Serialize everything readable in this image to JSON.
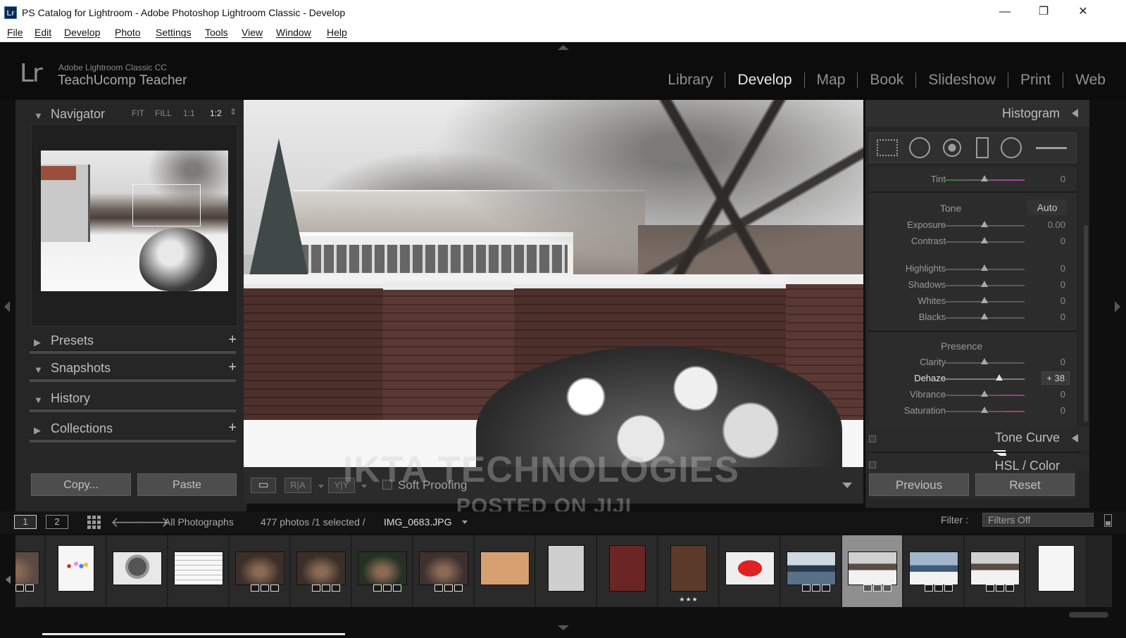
{
  "window": {
    "title": "PS Catalog for Lightroom - Adobe Photoshop Lightroom Classic - Develop",
    "app_icon": "Lr",
    "minimize": "—",
    "restore": "❐",
    "close": "✕"
  },
  "menu": [
    "File",
    "Edit",
    "Develop",
    "Photo",
    "Settings",
    "Tools",
    "View",
    "Window",
    "Help"
  ],
  "identity": {
    "logo": "Lr",
    "product": "Adobe Lightroom Classic CC",
    "user": "TeachUcomp Teacher"
  },
  "modules": [
    {
      "label": "Library",
      "active": false
    },
    {
      "label": "Develop",
      "active": true
    },
    {
      "label": "Map",
      "active": false
    },
    {
      "label": "Book",
      "active": false
    },
    {
      "label": "Slideshow",
      "active": false
    },
    {
      "label": "Print",
      "active": false
    },
    {
      "label": "Web",
      "active": false
    }
  ],
  "left_panel": {
    "navigator": {
      "label": "Navigator",
      "zoom_options": [
        "FIT",
        "FILL",
        "1:1",
        "1:2"
      ],
      "zoom_selected": "1:2",
      "zoom_arrows": "⇕"
    },
    "sections": [
      {
        "label": "Presets",
        "collapsed": true,
        "plus": "+"
      },
      {
        "label": "Snapshots",
        "collapsed": false,
        "plus": "+"
      },
      {
        "label": "History",
        "collapsed": false,
        "plus": ""
      },
      {
        "label": "Collections",
        "collapsed": true,
        "plus": "+"
      }
    ],
    "copy_label": "Copy...",
    "paste_label": "Paste"
  },
  "toolbar": {
    "view_mode": "▭",
    "ra_label": "R|A",
    "yy_label": "Y|Y",
    "soft_proofing": "Soft Proofing"
  },
  "watermark": {
    "line1": "IKTA TECHNOLOGIES",
    "line2": "POSTED ON JIJI"
  },
  "right_panel": {
    "histogram_label": "Histogram",
    "tools": [
      "crop-overlay-icon",
      "spot-removal-icon",
      "red-eye-icon",
      "graduated-filter-icon",
      "radial-filter-icon",
      "adjustment-brush-icon"
    ],
    "tint": {
      "label": "Tint",
      "value": "0",
      "position": 0.5
    },
    "tone": {
      "label": "Tone",
      "auto": "Auto",
      "sliders": [
        {
          "label": "Exposure",
          "value": "0.00",
          "position": 0.5
        },
        {
          "label": "Contrast",
          "value": "0",
          "position": 0.5
        },
        {
          "label": "Highlights",
          "value": "0",
          "position": 0.5
        },
        {
          "label": "Shadows",
          "value": "0",
          "position": 0.5
        },
        {
          "label": "Whites",
          "value": "0",
          "position": 0.5
        },
        {
          "label": "Blacks",
          "value": "0",
          "position": 0.5
        }
      ]
    },
    "presence": {
      "label": "Presence",
      "sliders": [
        {
          "label": "Clarity",
          "value": "0",
          "position": 0.5,
          "active": false
        },
        {
          "label": "Dehaze",
          "value": "+ 38",
          "position": 0.69,
          "active": true
        },
        {
          "label": "Vibrance",
          "value": "0",
          "position": 0.5,
          "active": false
        },
        {
          "label": "Saturation",
          "value": "0",
          "position": 0.5,
          "active": false
        }
      ]
    },
    "tone_curve_label": "Tone Curve",
    "hsl_label": "HSL / Color",
    "previous_label": "Previous",
    "reset_label": "Reset"
  },
  "filmstrip_bar": {
    "screen1": "1",
    "screen2": "2",
    "source": "All Photographs",
    "count": "477 photos /1 selected /",
    "filename": "IMG_0683.JPG",
    "filter_label": "Filter :",
    "filter_value": "Filters Off"
  },
  "filmstrip": {
    "stars": "★★★",
    "thumbs": [
      {
        "kind": "dark",
        "bg": "#5a4a42"
      },
      {
        "kind": "white-dots",
        "bg": "#f4f4f4"
      },
      {
        "kind": "heart",
        "bg": "#d8d8d8"
      },
      {
        "kind": "document",
        "bg": "#f7f7f7"
      },
      {
        "kind": "dark",
        "bg": "#3c2f2a"
      },
      {
        "kind": "dark",
        "bg": "#3a2e29"
      },
      {
        "kind": "dark",
        "bg": "#263025"
      },
      {
        "kind": "dark",
        "bg": "#3f3030"
      },
      {
        "kind": "warm",
        "bg": "#d6a070"
      },
      {
        "kind": "plate",
        "bg": "#cfcfcf"
      },
      {
        "kind": "red",
        "bg": "#6a2524"
      },
      {
        "kind": "flowers",
        "bg": "#5b3a2a"
      },
      {
        "kind": "redtruck",
        "bg": "#c02828"
      },
      {
        "kind": "water",
        "bg": "#7a8894"
      },
      {
        "kind": "snow",
        "bg": "#bdbdbd"
      },
      {
        "kind": "snow-house",
        "bg": "#8ea0b4"
      },
      {
        "kind": "snow-tree",
        "bg": "#9a9a9a"
      },
      {
        "kind": "white",
        "bg": "#f5f5f5"
      }
    ]
  }
}
